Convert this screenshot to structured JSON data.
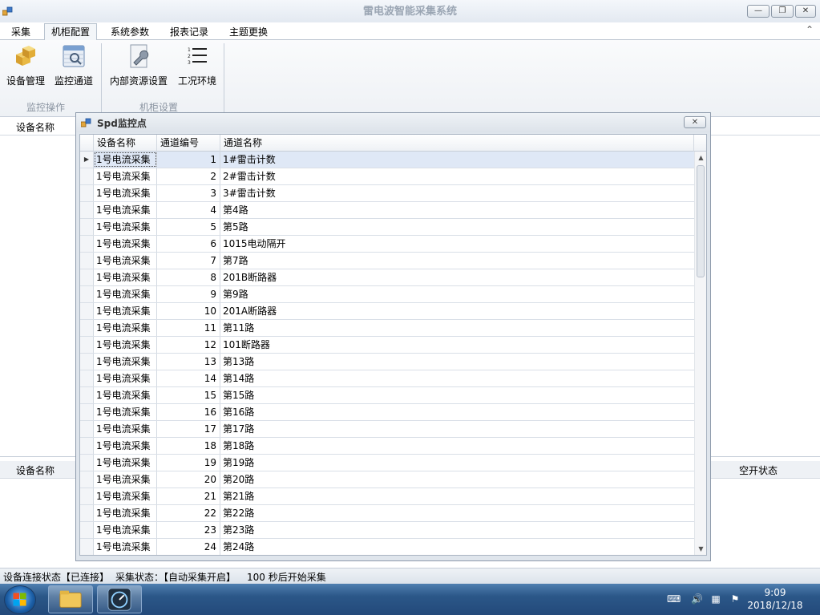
{
  "window": {
    "title": "雷电波智能采集系统"
  },
  "tabs": [
    {
      "label": "采集"
    },
    {
      "label": "机柜配置"
    },
    {
      "label": "系统参数"
    },
    {
      "label": "报表记录"
    },
    {
      "label": "主题更换"
    }
  ],
  "ribbon": {
    "buttons": [
      {
        "label": "设备管理",
        "icon": "cube-boxes-icon"
      },
      {
        "label": "监控通道",
        "icon": "monitor-channel-icon"
      },
      {
        "label": "内部资源设置",
        "icon": "wrench-settings-icon"
      },
      {
        "label": "工况环境",
        "icon": "numbered-list-icon"
      }
    ],
    "groups": [
      {
        "label": "监控操作"
      },
      {
        "label": "机柜设置"
      }
    ]
  },
  "background": {
    "top_grid": {
      "header_device": "设备名称"
    },
    "bottom_grid": {
      "header_device": "设备名称",
      "header_state": "空开状态"
    }
  },
  "dialog": {
    "title": "Spd监控点",
    "columns": [
      "设备名称",
      "通道编号",
      "通道名称"
    ],
    "rows": [
      {
        "device": "1号电流采集",
        "no": "1",
        "name": "1#雷击计数"
      },
      {
        "device": "1号电流采集",
        "no": "2",
        "name": "2#雷击计数"
      },
      {
        "device": "1号电流采集",
        "no": "3",
        "name": "3#雷击计数"
      },
      {
        "device": "1号电流采集",
        "no": "4",
        "name": "第4路"
      },
      {
        "device": "1号电流采集",
        "no": "5",
        "name": "第5路"
      },
      {
        "device": "1号电流采集",
        "no": "6",
        "name": "1015电动隔开"
      },
      {
        "device": "1号电流采集",
        "no": "7",
        "name": "第7路"
      },
      {
        "device": "1号电流采集",
        "no": "8",
        "name": "201B断路器"
      },
      {
        "device": "1号电流采集",
        "no": "9",
        "name": "第9路"
      },
      {
        "device": "1号电流采集",
        "no": "10",
        "name": "201A断路器"
      },
      {
        "device": "1号电流采集",
        "no": "11",
        "name": "第11路"
      },
      {
        "device": "1号电流采集",
        "no": "12",
        "name": "101断路器"
      },
      {
        "device": "1号电流采集",
        "no": "13",
        "name": "第13路"
      },
      {
        "device": "1号电流采集",
        "no": "14",
        "name": "第14路"
      },
      {
        "device": "1号电流采集",
        "no": "15",
        "name": "第15路"
      },
      {
        "device": "1号电流采集",
        "no": "16",
        "name": "第16路"
      },
      {
        "device": "1号电流采集",
        "no": "17",
        "name": "第17路"
      },
      {
        "device": "1号电流采集",
        "no": "18",
        "name": "第18路"
      },
      {
        "device": "1号电流采集",
        "no": "19",
        "name": "第19路"
      },
      {
        "device": "1号电流采集",
        "no": "20",
        "name": "第20路"
      },
      {
        "device": "1号电流采集",
        "no": "21",
        "name": "第21路"
      },
      {
        "device": "1号电流采集",
        "no": "22",
        "name": "第22路"
      },
      {
        "device": "1号电流采集",
        "no": "23",
        "name": "第23路"
      },
      {
        "device": "1号电流采集",
        "no": "24",
        "name": "第24路"
      }
    ]
  },
  "statusbar": {
    "conn": "设备连接状态【已连接】",
    "collect": "采集状态：【自动采集开启】",
    "countdown": "100 秒后开始采集"
  },
  "taskbar": {
    "time": "9:09",
    "date": "2018/12/18"
  }
}
